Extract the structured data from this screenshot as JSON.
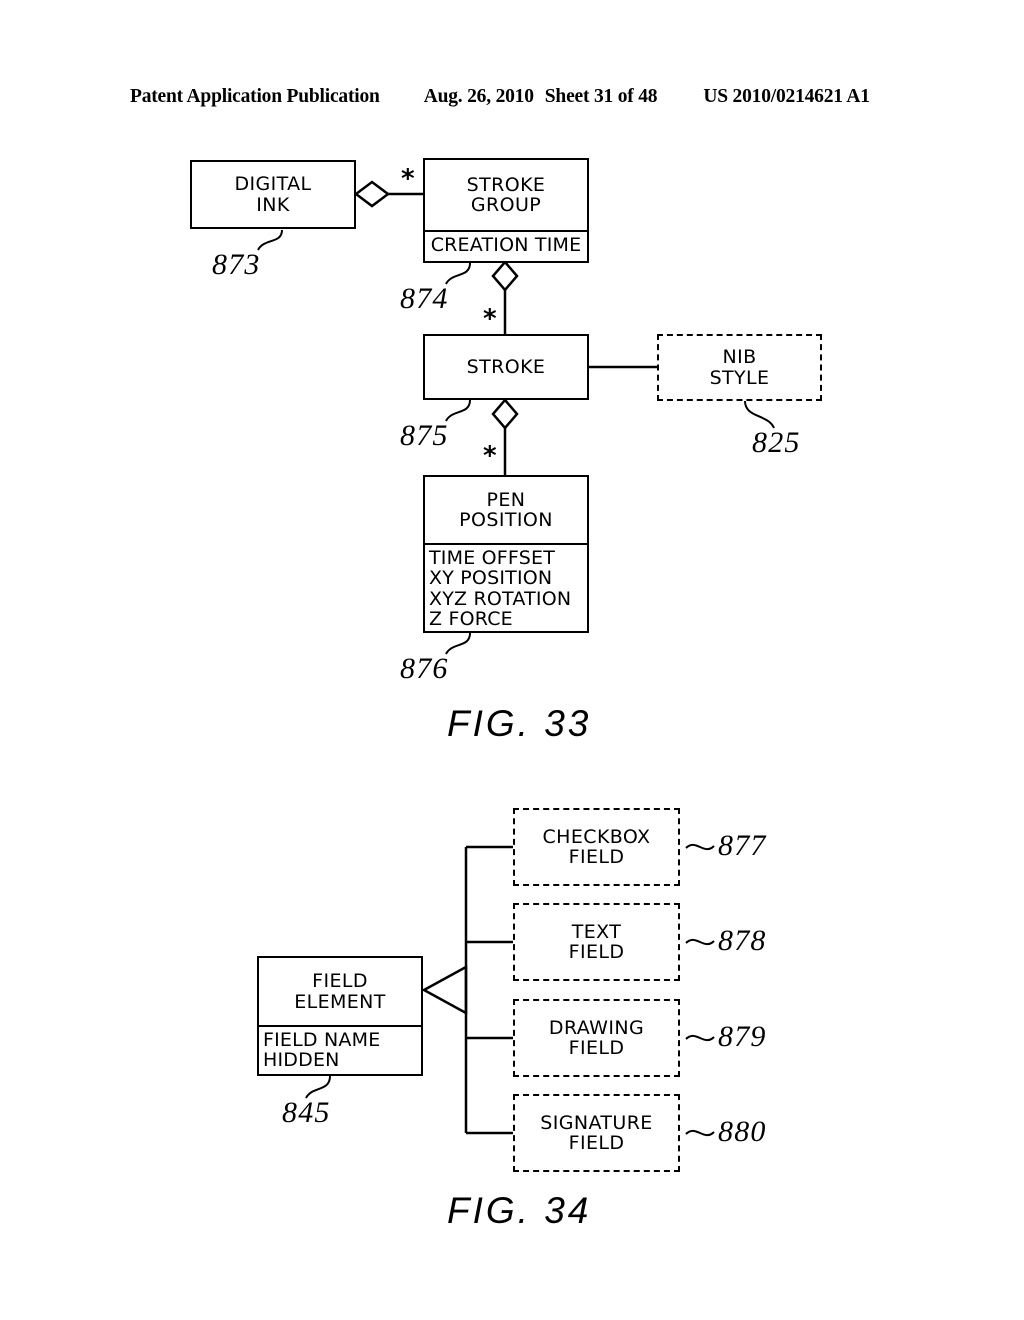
{
  "header": {
    "publication": "Patent Application Publication",
    "date": "Aug. 26, 2010",
    "sheet": "Sheet 31 of 48",
    "patent_number": "US 2010/0214621 A1"
  },
  "figures": [
    {
      "caption": "FIG. 33",
      "nodes": [
        {
          "key": "digital_ink",
          "title": "DIGITAL\nINK",
          "attributes": "",
          "ref": "873",
          "style": "solid"
        },
        {
          "key": "stroke_group",
          "title": "STROKE\nGROUP",
          "attributes": "CREATION TIME",
          "ref": "874",
          "style": "solid"
        },
        {
          "key": "stroke",
          "title": "STROKE",
          "attributes": "",
          "ref": "875",
          "style": "solid"
        },
        {
          "key": "nib_style",
          "title": "NIB\nSTYLE",
          "attributes": "",
          "ref": "825",
          "style": "dashed"
        },
        {
          "key": "pen_position",
          "title": "PEN\nPOSITION",
          "attributes": "TIME OFFSET\nXY POSITION\nXYZ ROTATION\nZ FORCE",
          "ref": "876",
          "style": "solid"
        }
      ],
      "multiplicities": [
        "*",
        "*",
        "*"
      ]
    },
    {
      "caption": "FIG. 34",
      "nodes": [
        {
          "key": "field_element",
          "title": "FIELD\nELEMENT",
          "attributes": "FIELD NAME\nHIDDEN",
          "ref": "845",
          "style": "solid"
        },
        {
          "key": "checkbox_field",
          "title": "CHECKBOX\nFIELD",
          "attributes": "",
          "ref": "877",
          "style": "dashed"
        },
        {
          "key": "text_field",
          "title": "TEXT\nFIELD",
          "attributes": "",
          "ref": "878",
          "style": "dashed"
        },
        {
          "key": "drawing_field",
          "title": "DRAWING\nFIELD",
          "attributes": "",
          "ref": "879",
          "style": "dashed"
        },
        {
          "key": "signature_field",
          "title": "SIGNATURE\nFIELD",
          "attributes": "",
          "ref": "880",
          "style": "dashed"
        }
      ]
    }
  ]
}
